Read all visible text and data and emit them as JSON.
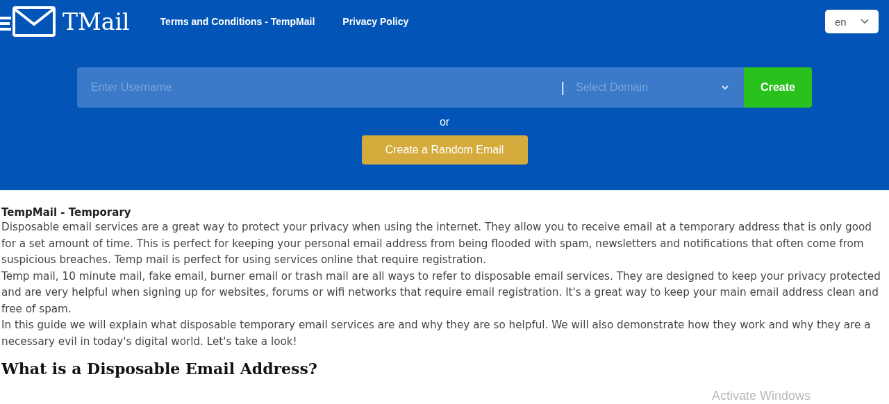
{
  "header": {
    "logo": "TMail",
    "nav": [
      "Terms and Conditions - TempMail",
      "Privacy Policy"
    ],
    "language": {
      "value": "en"
    }
  },
  "form": {
    "username": {
      "placeholder": "Enter Username"
    },
    "separator": "|",
    "domain": {
      "placeholder": "Select Domain"
    },
    "create_button": "Create",
    "or": "or",
    "random_button": "Create a Random Email"
  },
  "article": {
    "title": "TempMail - Temporary",
    "paragraphs": [
      "Disposable email services are a great way to protect your privacy when using the internet. They allow you to receive email at a temporary address that is only good for a set amount of time. This is perfect for keeping your personal email address from being flooded with spam, newsletters and notifications that often come from suspicious breaches. Temp mail is perfect for using services online that require registration.",
      "Temp mail, 10 minute mail, fake email, burner email or trash mail are all ways to refer to disposable email services. They are designed to keep your privacy protected and are very helpful when signing up for websites, forums or wifi networks that require email registration. It's a great way to keep your main email address clean and free of spam.",
      "In this guide we will explain what disposable temporary email services are and why they are so helpful. We will also demonstrate how they work and why they are a necessary evil in today's digital world. Let's take a look!"
    ],
    "heading": "What is a Disposable Email Address?"
  },
  "overlay": "Activate Windows"
}
